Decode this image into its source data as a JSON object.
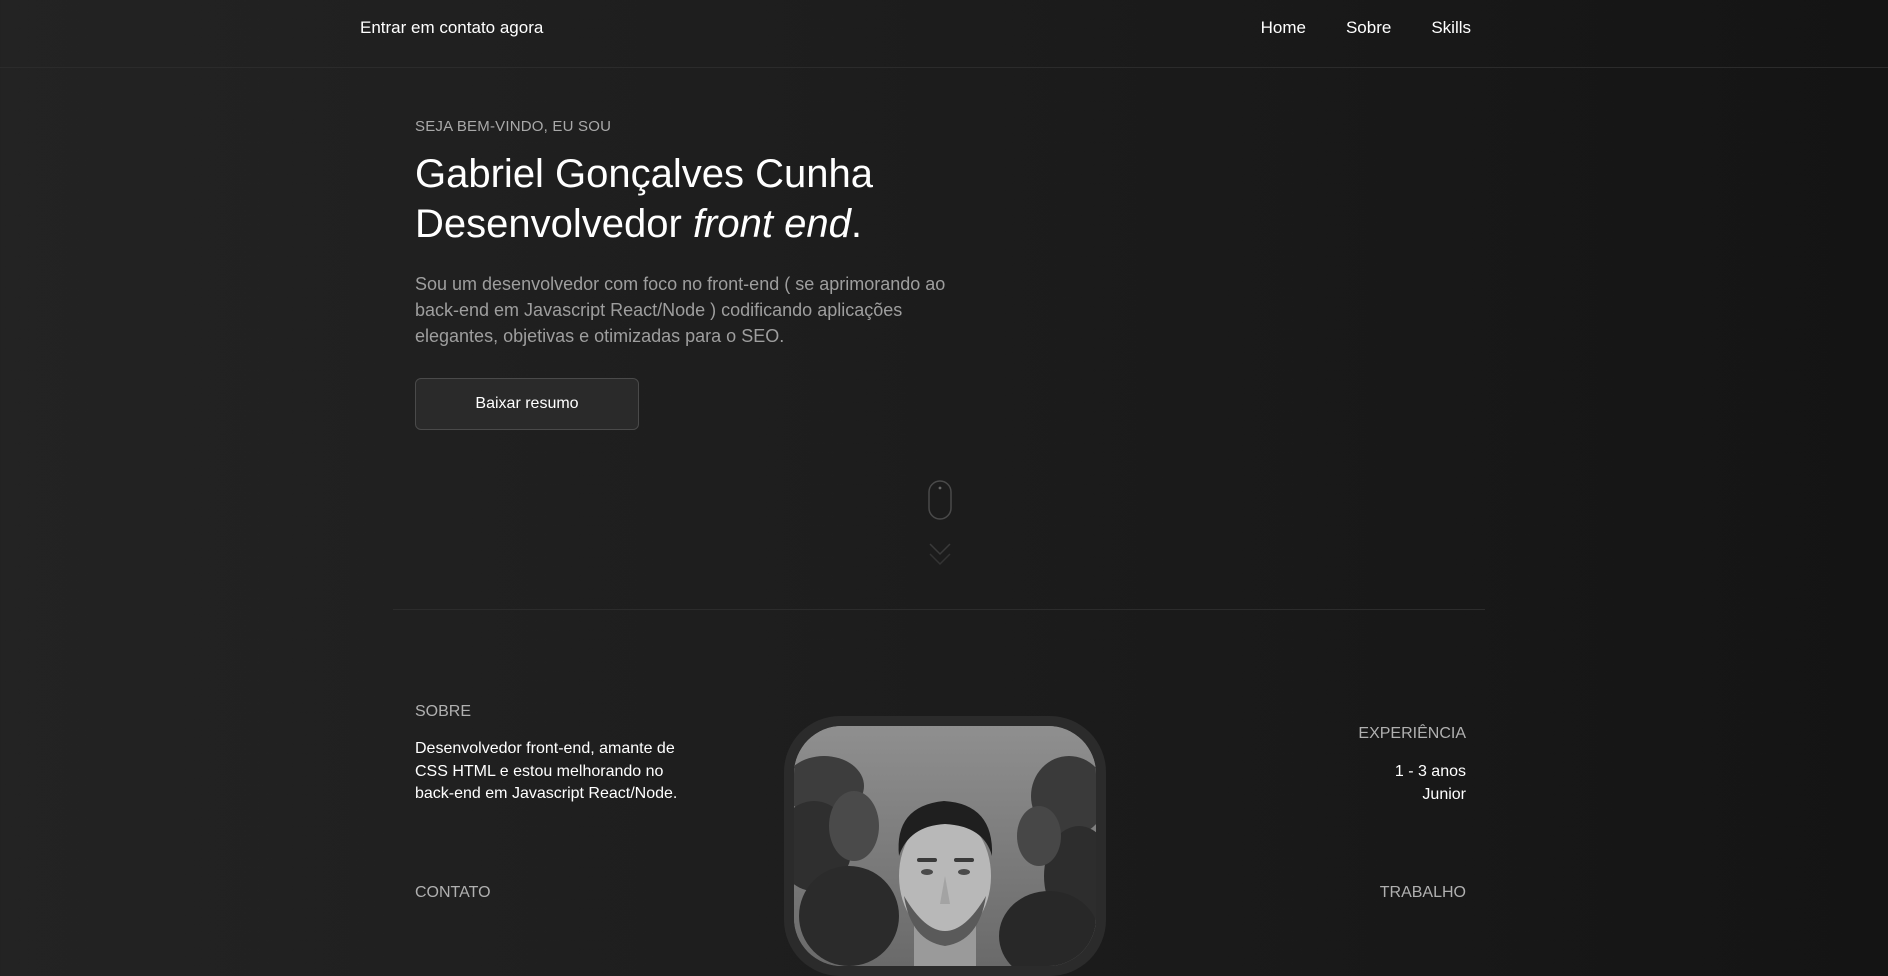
{
  "header": {
    "contact_link": "Entrar em contato agora",
    "nav": [
      "Home",
      "Sobre",
      "Skills"
    ]
  },
  "hero": {
    "eyebrow": "SEJA BEM-VINDO, EU SOU",
    "name": "Gabriel Gonçalves Cunha",
    "role_prefix": "Desenvolvedor ",
    "role_italic": "front end",
    "role_suffix": ".",
    "description": "Sou um desenvolvedor com foco no front-end ( se aprimorando ao back-end em Javascript React/Node ) codificando aplicações elegantes, objetivas e otimizadas para o SEO.",
    "cta_label": "Baixar resumo"
  },
  "scroll_indicator": {
    "icons": [
      "mouse-icon",
      "chevrons-down-icon"
    ]
  },
  "about": {
    "label": "SOBRE",
    "text": "Desenvolvedor front-end, amante de CSS HTML e estou melhorando no back-end em Javascript React/Node.",
    "contact_label": "CONTATO"
  },
  "experience": {
    "label": "EXPERIÊNCIA",
    "years": "1 - 3 anos",
    "level": "Junior",
    "work_label": "TRABALHO"
  },
  "colors": {
    "background_left": "#232323",
    "background_right": "#141414",
    "text_primary": "#ffffff",
    "text_muted": "#9e9e9e",
    "button_bg": "#2a2a2a",
    "button_border": "#4a4a4a"
  }
}
